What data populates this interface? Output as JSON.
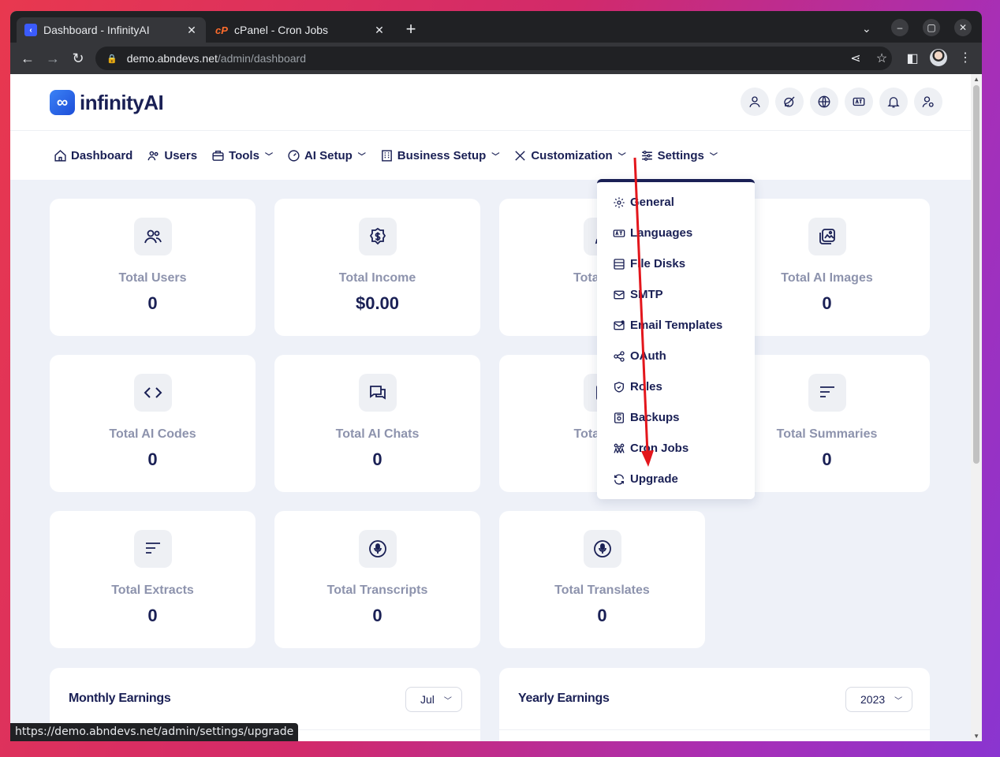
{
  "browser": {
    "tabs": [
      {
        "title": "Dashboard - InfinityAI",
        "active": true
      },
      {
        "title": "cPanel - Cron Jobs",
        "active": false
      }
    ],
    "new_tab": "+",
    "close": "✕",
    "url_host": "demo.abndevs.net",
    "url_path": "/admin/dashboard",
    "status_url": "https://demo.abndevs.net/admin/settings/upgrade"
  },
  "header": {
    "logo_text": "infinityAI",
    "icons": [
      "user-icon",
      "brush-icon",
      "globe-icon",
      "language-icon",
      "bell-icon",
      "user-settings-icon"
    ]
  },
  "nav": {
    "items": [
      {
        "label": "Dashboard",
        "icon": "home-icon",
        "dropdown": false
      },
      {
        "label": "Users",
        "icon": "users-icon",
        "dropdown": false
      },
      {
        "label": "Tools",
        "icon": "toolbox-icon",
        "dropdown": true
      },
      {
        "label": "AI Setup",
        "icon": "gauge-icon",
        "dropdown": true
      },
      {
        "label": "Business Setup",
        "icon": "building-icon",
        "dropdown": true
      },
      {
        "label": "Customization",
        "icon": "tools-icon",
        "dropdown": true
      },
      {
        "label": "Settings",
        "icon": "sliders-icon",
        "dropdown": true
      }
    ]
  },
  "settings_menu": {
    "items": [
      {
        "label": "General",
        "icon": "gear-icon"
      },
      {
        "label": "Languages",
        "icon": "language-icon"
      },
      {
        "label": "File Disks",
        "icon": "database-icon"
      },
      {
        "label": "SMTP",
        "icon": "mail-icon"
      },
      {
        "label": "Email Templates",
        "icon": "mail-template-icon"
      },
      {
        "label": "OAuth",
        "icon": "share-icon"
      },
      {
        "label": "Roles",
        "icon": "shield-icon"
      },
      {
        "label": "Backups",
        "icon": "backup-icon"
      },
      {
        "label": "Cron Jobs",
        "icon": "cron-icon"
      },
      {
        "label": "Upgrade",
        "icon": "refresh-icon"
      }
    ]
  },
  "stats": [
    {
      "label": "Total Users",
      "value": "0",
      "icon": "users-icon"
    },
    {
      "label": "Total Income",
      "value": "$0.00",
      "icon": "dollar-icon"
    },
    {
      "label": "Total AI D",
      "value": "",
      "icon": "pen-icon"
    },
    {
      "label": "Total AI Images",
      "value": "0",
      "icon": "image-icon"
    },
    {
      "label": "Total AI Codes",
      "value": "0",
      "icon": "code-icon"
    },
    {
      "label": "Total AI Chats",
      "value": "0",
      "icon": "chat-icon"
    },
    {
      "label": "Total AI S",
      "value": "",
      "icon": "doc-icon"
    },
    {
      "label": "Total Summaries",
      "value": "0",
      "icon": "lines-icon"
    },
    {
      "label": "Total Extracts",
      "value": "0",
      "icon": "lines-icon"
    },
    {
      "label": "Total Transcripts",
      "value": "0",
      "icon": "mic-icon"
    },
    {
      "label": "Total Translates",
      "value": "0",
      "icon": "mic-icon"
    }
  ],
  "earnings": {
    "monthly": {
      "title": "Monthly Earnings",
      "selected": "Jul"
    },
    "yearly": {
      "title": "Yearly Earnings",
      "selected": "2023"
    }
  },
  "colors": {
    "accent": "#1a2055",
    "muted": "#8d93ad",
    "annotation": "#e3161c"
  }
}
